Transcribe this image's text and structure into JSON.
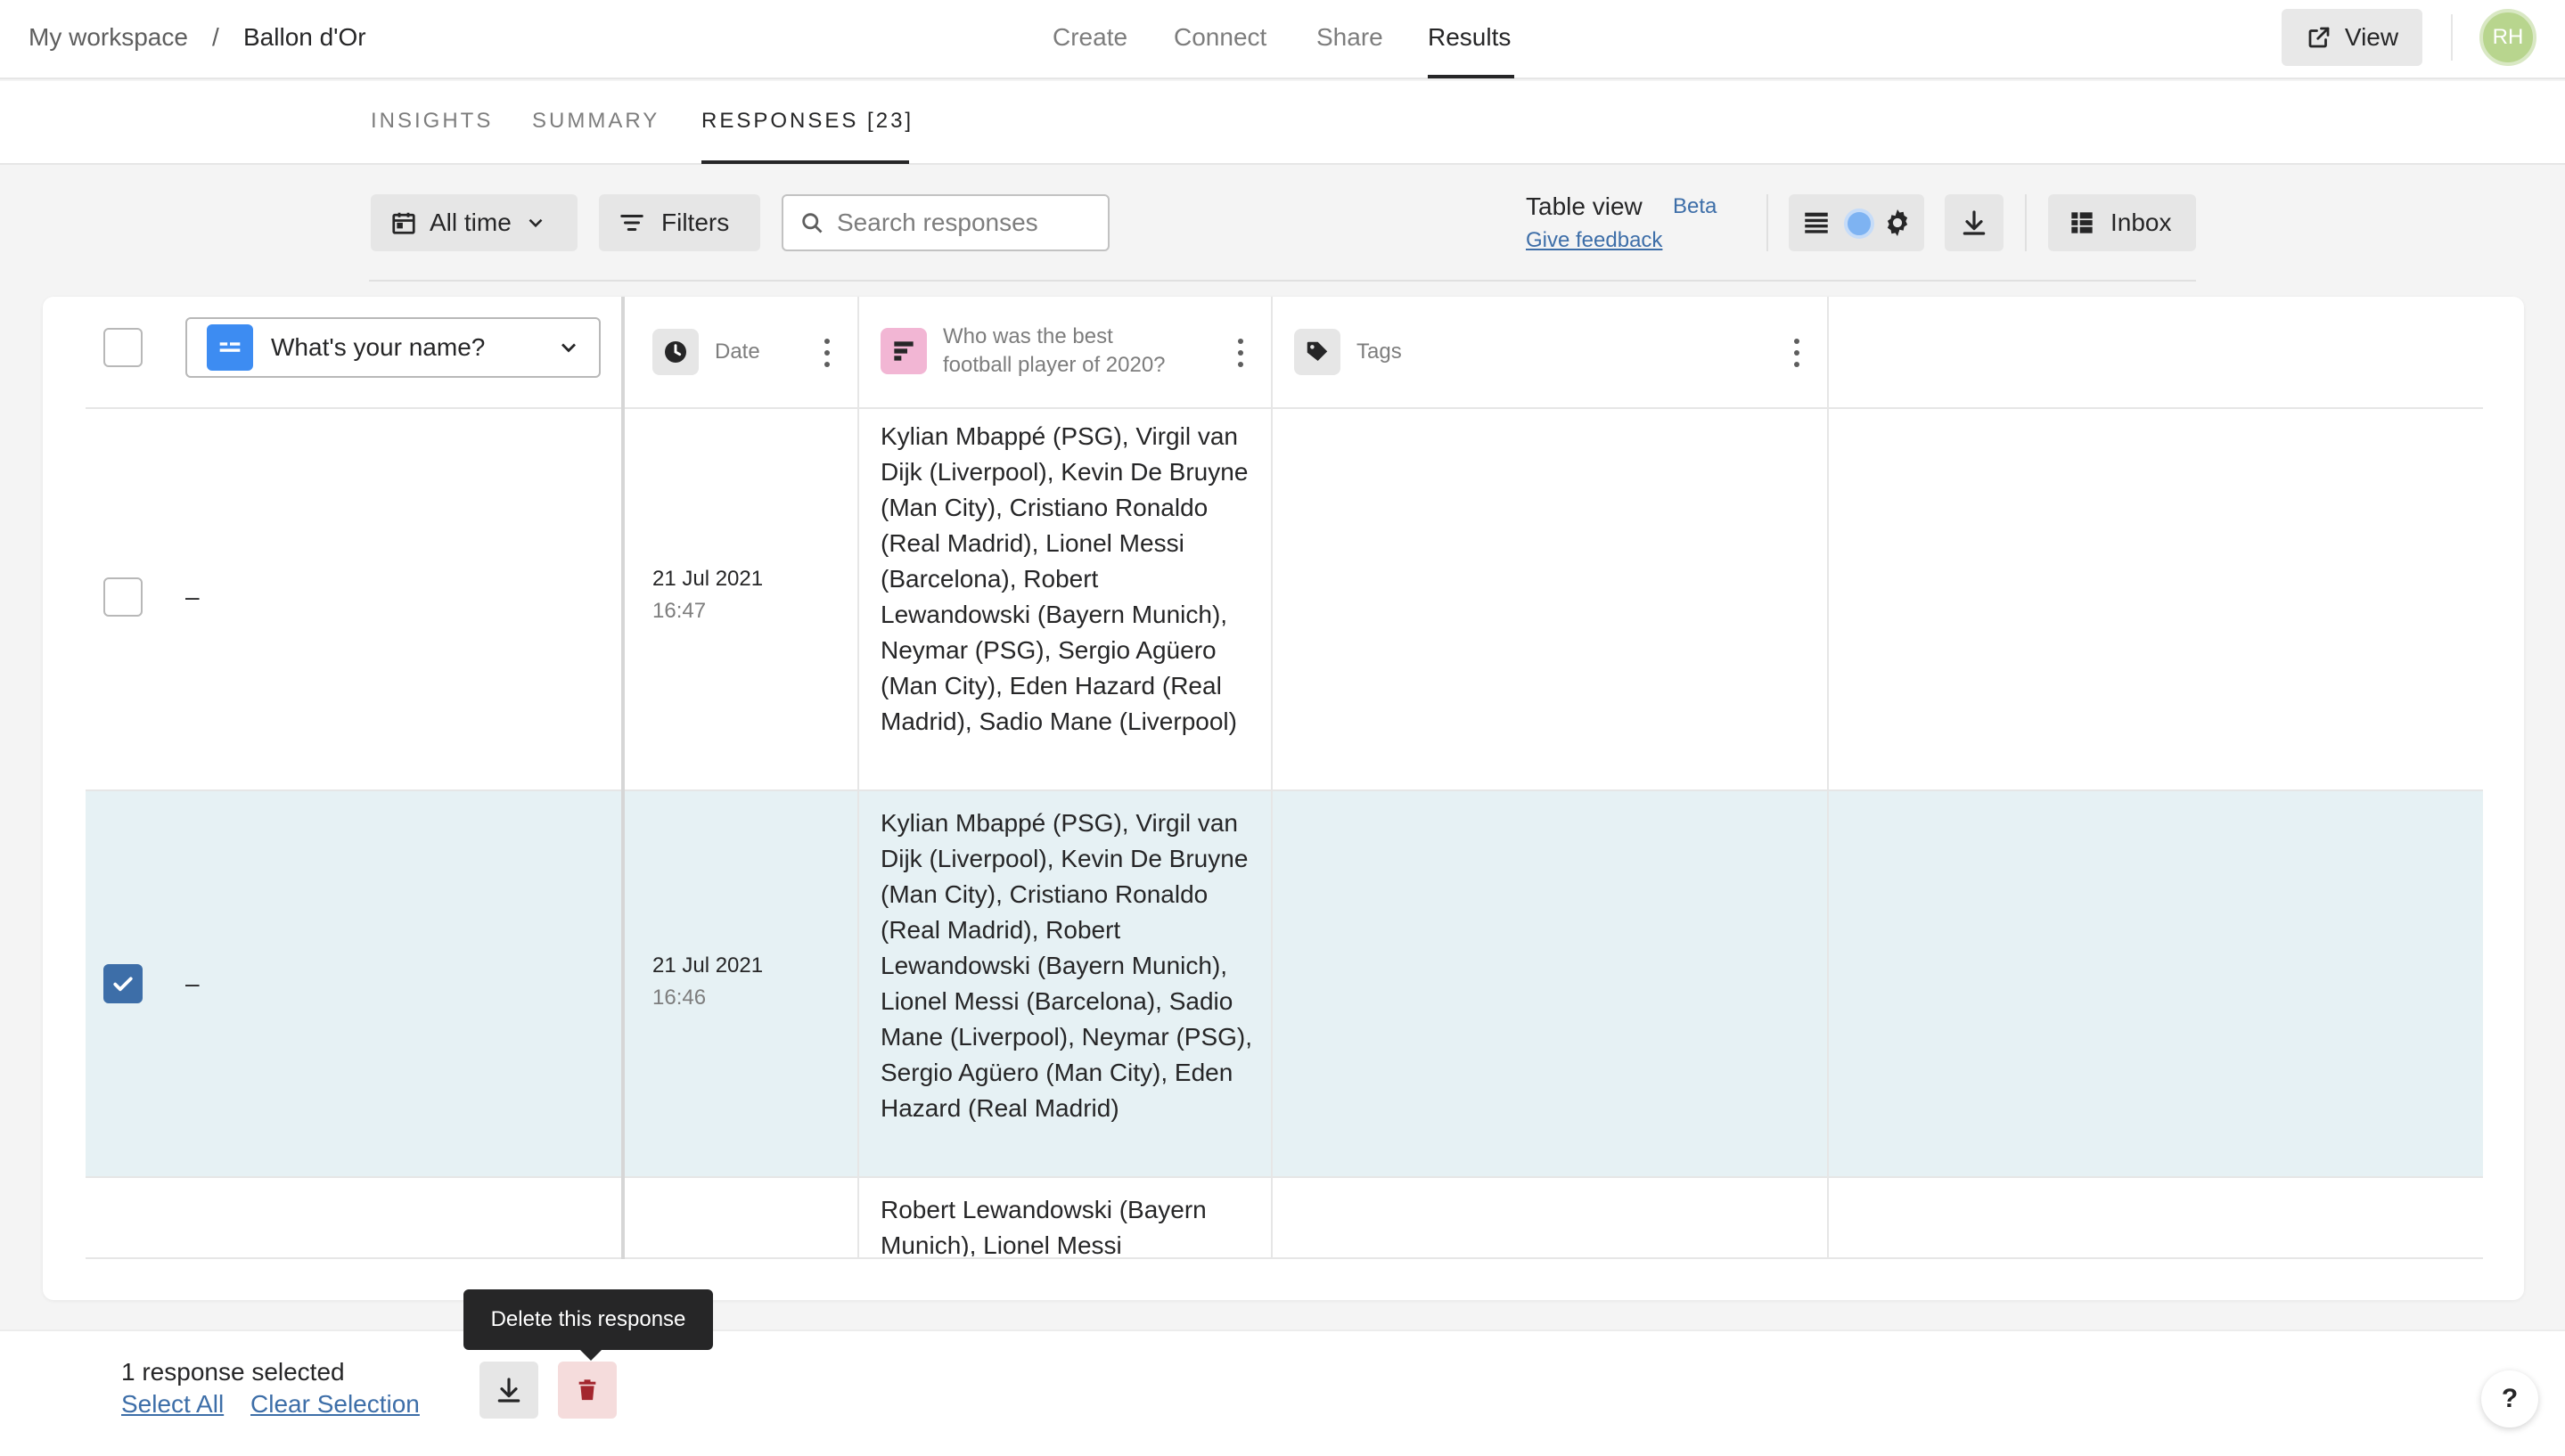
{
  "breadcrumb": {
    "workspace": "My workspace",
    "separator": "/",
    "form": "Ballon d'Or"
  },
  "nav": {
    "items": [
      "Create",
      "Connect",
      "Share",
      "Results"
    ],
    "active": "Results"
  },
  "header": {
    "view_label": "View",
    "avatar_initials": "RH"
  },
  "subtabs": {
    "insights": "INSIGHTS",
    "summary": "SUMMARY",
    "responses": "RESPONSES [23]"
  },
  "toolbar": {
    "date_filter": "All time",
    "filters_label": "Filters",
    "search_placeholder": "Search responses",
    "table_view_label": "Table view",
    "beta_label": "Beta",
    "feedback_label": "Give feedback",
    "inbox_label": "Inbox"
  },
  "table": {
    "question_select": "What's your name?",
    "columns": {
      "date": "Date",
      "question_line1": "Who was the best",
      "question_line2": "football player of 2020?",
      "tags": "Tags"
    },
    "rows": [
      {
        "name": "–",
        "date": "21 Jul 2021",
        "time": "16:47",
        "selected": false,
        "answer": "Kylian Mbappé (PSG), Virgil van Dijk (Liverpool), Kevin De Bruyne (Man City), Cristiano Ronaldo (Real Madrid), Lionel Messi (Barcelona), Robert Lewandowski (Bayern Munich), Neymar (PSG), Sergio Agüero (Man City), Eden Hazard (Real Madrid), Sadio Mane (Liverpool)"
      },
      {
        "name": "–",
        "date": "21 Jul 2021",
        "time": "16:46",
        "selected": true,
        "answer": "Kylian Mbappé (PSG), Virgil van Dijk (Liverpool), Kevin De Bruyne (Man City), Cristiano Ronaldo (Real Madrid), Robert Lewandowski (Bayern Munich), Lionel Messi (Barcelona), Sadio Mane (Liverpool), Neymar (PSG), Sergio Agüero (Man City), Eden Hazard (Real Madrid)"
      },
      {
        "name": "",
        "date": "",
        "time": "",
        "selected": false,
        "answer": "Robert Lewandowski (Bayern Munich), Lionel Messi"
      }
    ]
  },
  "selection": {
    "count_label": "1 response selected",
    "select_all": "Select All",
    "clear_selection": "Clear Selection",
    "tooltip": "Delete this response"
  },
  "help_label": "?",
  "colors": {
    "accent_blue": "#3d6ea8",
    "selected_row": "#e6f1f4",
    "delete_red": "#a3262e",
    "question_icon": "#3d8cf2",
    "multi_choice_icon": "#f2b6d4"
  }
}
